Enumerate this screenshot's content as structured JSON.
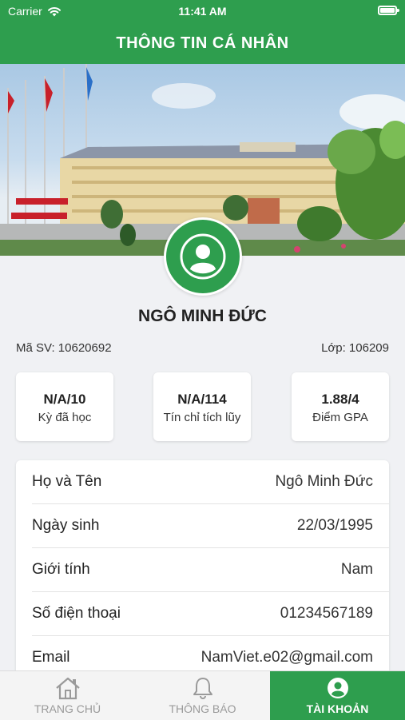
{
  "status_bar": {
    "carrier": "Carrier",
    "time": "11:41 AM"
  },
  "nav": {
    "title": "THÔNG TIN CÁ NHÂN"
  },
  "profile": {
    "name": "NGÔ MINH ĐỨC",
    "student_id_label": "Mã SV: 10620692",
    "class_label": "Lớp: 106209"
  },
  "stats": [
    {
      "value": "N/A/10",
      "label": "Kỳ đã học"
    },
    {
      "value": "N/A/114",
      "label": "Tín chỉ tích lũy"
    },
    {
      "value": "1.88/4",
      "label": "Điểm GPA"
    }
  ],
  "info": [
    {
      "label": "Họ và Tên",
      "value": "Ngô Minh Đức"
    },
    {
      "label": "Ngày sinh",
      "value": "22/03/1995"
    },
    {
      "label": "Giới tính",
      "value": "Nam"
    },
    {
      "label": "Số điện thoại",
      "value": "01234567189"
    },
    {
      "label": "Email",
      "value": "NamViet.e02@gmail.com"
    }
  ],
  "tabs": [
    {
      "label": "TRANG CHỦ",
      "icon": "home-icon",
      "active": false
    },
    {
      "label": "THÔNG BÁO",
      "icon": "bell-icon",
      "active": false
    },
    {
      "label": "TÀI KHOẢN",
      "icon": "account-icon",
      "active": true
    }
  ],
  "colors": {
    "primary": "#2e9e4e",
    "inactive_tab": "#9a9a9a"
  }
}
